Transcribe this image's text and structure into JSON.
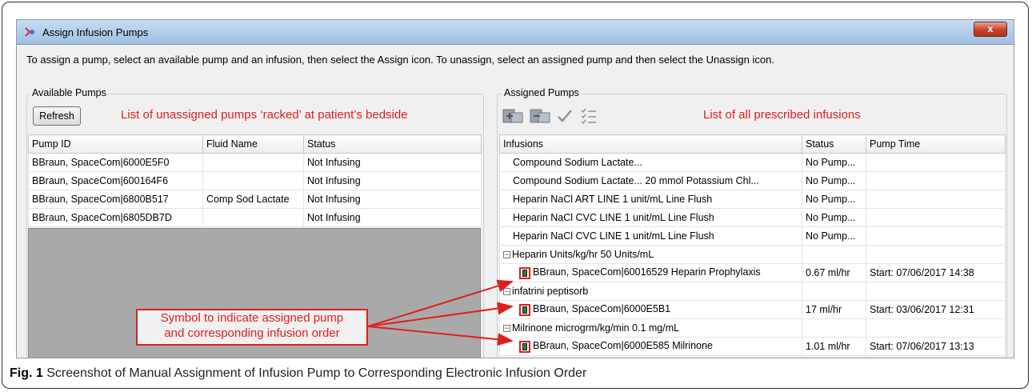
{
  "window": {
    "title": "Assign Infusion Pumps",
    "close_label": "x"
  },
  "instruction": "To assign a pump, select an available pump and an infusion, then select the Assign icon. To unassign, select an assigned pump and then select the Unassign icon.",
  "available": {
    "group_label": "Available Pumps",
    "refresh_label": "Refresh",
    "annotation": "List of unassigned pumps ‘racked’ at patient’s bedside",
    "columns": [
      "Pump ID",
      "Fluid Name",
      "Status"
    ],
    "rows": [
      [
        "BBraun, SpaceCom|6000E5F0",
        "",
        "Not Infusing"
      ],
      [
        "BBraun, SpaceCom|600164F6",
        "",
        "Not Infusing"
      ],
      [
        "BBraun, SpaceCom|6800B517",
        "Comp Sod Lactate",
        "Not Infusing"
      ],
      [
        "BBraun, SpaceCom|6805DB7D",
        "",
        "Not Infusing"
      ]
    ]
  },
  "assigned": {
    "group_label": "Assigned Pumps",
    "annotation": "List of all prescribed infusions",
    "toolbar_icons": [
      "assign-icon",
      "unassign-icon",
      "checkmark-icon",
      "checklist-icon"
    ],
    "columns": [
      "Infusions",
      "Status",
      "Pump Time"
    ],
    "rows": [
      {
        "kind": "item",
        "infusion": "Compound Sodium Lactate...",
        "status": "No Pump...",
        "time": ""
      },
      {
        "kind": "item",
        "infusion": "Compound Sodium Lactate... 20 mmol Potassium Chl...",
        "status": "No Pump...",
        "time": ""
      },
      {
        "kind": "item",
        "infusion": "Heparin NaCl ART LINE 1 unit/mL Line Flush",
        "status": "No Pump...",
        "time": ""
      },
      {
        "kind": "item",
        "infusion": "Heparin NaCl CVC LINE 1 unit/mL Line Flush",
        "status": "No Pump...",
        "time": ""
      },
      {
        "kind": "item",
        "infusion": "Heparin NaCl CVC LINE 1 unit/mL Line Flush",
        "status": "No Pump...",
        "time": ""
      },
      {
        "kind": "group",
        "infusion": "Heparin Units/kg/hr 50 Units/mL",
        "status": "",
        "time": ""
      },
      {
        "kind": "pump",
        "infusion": "BBraun, SpaceCom|60016529 Heparin Prophylaxis",
        "status": "0.67 ml/hr",
        "time": "Start: 07/06/2017 14:38"
      },
      {
        "kind": "group",
        "infusion": "infatrini peptisorb",
        "status": "",
        "time": ""
      },
      {
        "kind": "pump",
        "infusion": "BBraun, SpaceCom|6000E5B1",
        "status": "17 ml/hr",
        "time": "Start: 03/06/2017 12:31"
      },
      {
        "kind": "group",
        "infusion": "Milrinone microgrm/kg/min 0.1 mg/mL",
        "status": "",
        "time": ""
      },
      {
        "kind": "pump",
        "infusion": "BBraun, SpaceCom|6000E585 Milrinone",
        "status": "1.01 ml/hr",
        "time": "Start: 07/06/2017 13:13"
      }
    ]
  },
  "callout": {
    "line1": "Symbol to indicate assigned pump",
    "line2": "and corresponding infusion order"
  },
  "caption": {
    "label": "Fig. 1",
    "text": "Screenshot of Manual Assignment of Infusion Pump to Corresponding Electronic Infusion Order"
  },
  "colors": {
    "annotation": "#e01e1e",
    "empty_area": "#a9a9a9"
  }
}
